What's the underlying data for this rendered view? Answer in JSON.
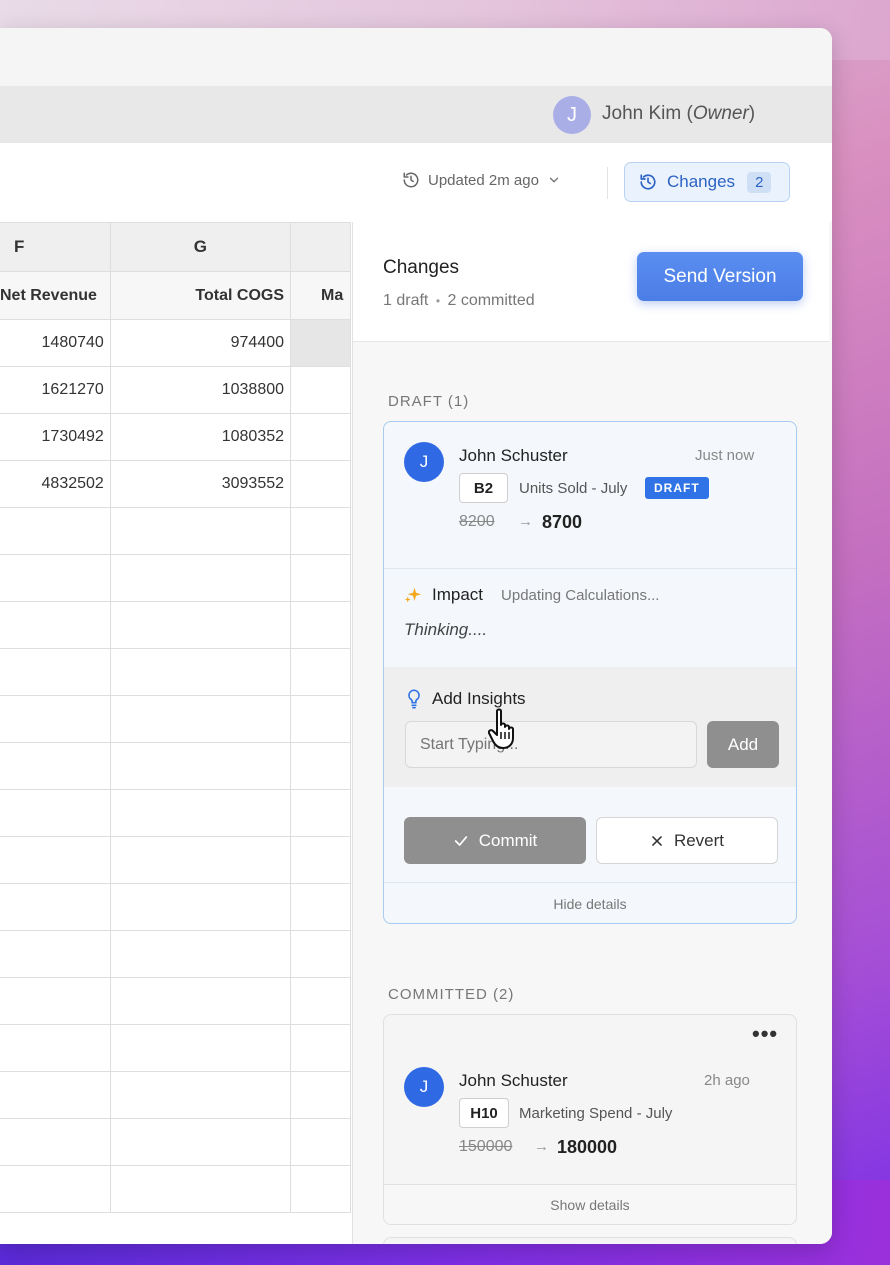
{
  "user": {
    "initial": "J",
    "name": "John Kim",
    "role": "Owner"
  },
  "toolbar": {
    "updated_text": "Updated 2m ago",
    "changes_label": "Changes",
    "changes_count": "2"
  },
  "sheet": {
    "columns": [
      "F",
      "G",
      ""
    ],
    "fields": [
      "Net Revenue",
      "Total COGS",
      "Ma"
    ],
    "rows": [
      [
        "1480740",
        "974400"
      ],
      [
        "1621270",
        "1038800"
      ],
      [
        "1730492",
        "1080352"
      ],
      [
        "4832502",
        "3093552"
      ]
    ]
  },
  "panel": {
    "title": "Changes",
    "summary_a": "1 draft",
    "summary_sep": "•",
    "summary_b": "2 committed",
    "send_label": "Send Version",
    "draft_section": "DRAFT (1)",
    "committed_section": "COMMITTED (2)"
  },
  "draft": {
    "initial": "J",
    "author": "John Schuster",
    "time": "Just now",
    "cell": "B2",
    "cell_desc": "Units Sold - July",
    "badge": "DRAFT",
    "old_value": "8200",
    "arrow": "→",
    "new_value": "8700",
    "impact_label": "Impact",
    "impact_status": "Updating Calculations...",
    "thinking": "Thinking....",
    "insights_label": "Add Insights",
    "insights_placeholder": "Start Typing...",
    "add_label": "Add",
    "commit_label": "Commit",
    "revert_label": "Revert",
    "hide_details": "Hide details"
  },
  "committed": [
    {
      "initial": "J",
      "author": "John Schuster",
      "time": "2h ago",
      "cell": "H10",
      "cell_desc": "Marketing Spend - July",
      "old_value": "150000",
      "arrow": "→",
      "new_value": "180000",
      "show_details": "Show details",
      "more": "•••"
    },
    {
      "more": "•••"
    }
  ],
  "colors": {
    "accent": "#2f69e3",
    "draft_border": "#a9cbef",
    "impact_icon": "#f2a81d"
  }
}
